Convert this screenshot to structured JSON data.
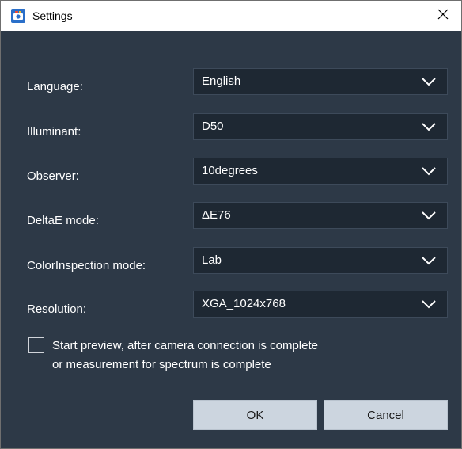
{
  "window": {
    "title": "Settings",
    "close_symbol": "✕"
  },
  "settings": {
    "language": {
      "label": "Language:",
      "value": "English"
    },
    "illuminant": {
      "label": "Illuminant:",
      "value": "D50"
    },
    "observer": {
      "label": "Observer:",
      "value": "10degrees"
    },
    "deltae_mode": {
      "label": "DeltaE mode:",
      "value": "ΔE76"
    },
    "colorinspection_mode": {
      "label": "ColorInspection mode:",
      "value": "Lab"
    },
    "resolution": {
      "label": "Resolution:",
      "value": "XGA_1024x768"
    }
  },
  "start_preview": {
    "checked": false,
    "label_line1": "Start preview, after camera connection is complete",
    "label_line2": "or measurement for spectrum is complete"
  },
  "buttons": {
    "ok": "OK",
    "cancel": "Cancel"
  },
  "icons": {
    "app": "camera-app-icon",
    "close": "close-icon",
    "dropdown": "chevron-down-icon"
  },
  "colors": {
    "background": "#2d3947",
    "select_bg": "#1e2833",
    "button_bg": "#ccd5df"
  }
}
